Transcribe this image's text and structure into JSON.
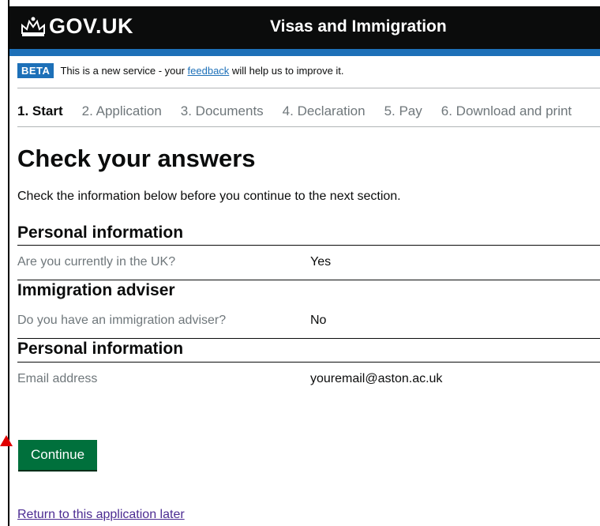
{
  "header": {
    "logo_text": "GOV.UK",
    "service_name": "Visas and Immigration"
  },
  "beta": {
    "tag": "BETA",
    "text_before": "This is a new service - your ",
    "link": "feedback",
    "text_after": " will help us to improve it."
  },
  "steps": [
    {
      "label": "1. Start",
      "active": true
    },
    {
      "label": "2. Application"
    },
    {
      "label": "3. Documents"
    },
    {
      "label": "4. Declaration"
    },
    {
      "label": "5. Pay"
    },
    {
      "label": "6. Download and print"
    }
  ],
  "page": {
    "title": "Check your answers",
    "intro": "Check the information below before you continue to the next section."
  },
  "sections": [
    {
      "heading": "Personal information",
      "key": "Are you currently in the UK?",
      "value": "Yes"
    },
    {
      "heading": "Immigration adviser",
      "key": "Do you have an immigration adviser?",
      "value": "No"
    },
    {
      "heading": "Personal information",
      "key": "Email address",
      "value": "youremail@aston.ac.uk"
    }
  ],
  "actions": {
    "continue": "Continue",
    "return_later": "Return to this application later"
  },
  "colors": {
    "header_bg": "#0b0c0c",
    "brand_blue": "#1d70b8",
    "button_green": "#00703c",
    "link_visited": "#4c2c92",
    "annotation_red": "#e00000"
  }
}
